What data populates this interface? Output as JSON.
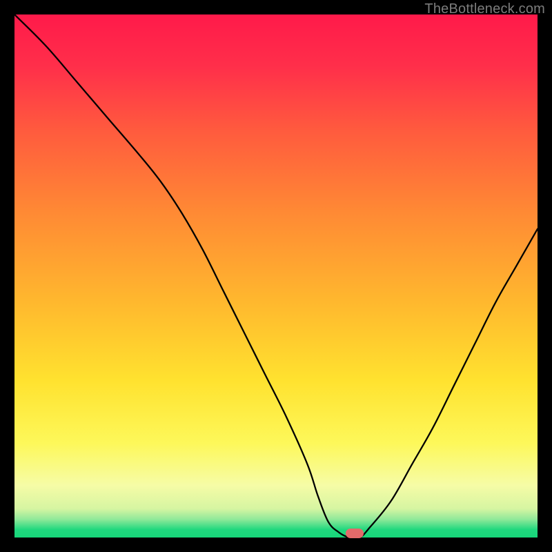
{
  "watermark": "TheBottleneck.com",
  "colors": {
    "black": "#000000",
    "curve_stroke": "#000000",
    "marker_fill": "#e46a6a",
    "gradient_stops": [
      {
        "pos": 0.0,
        "color": "#ff1a4a"
      },
      {
        "pos": 0.1,
        "color": "#ff2f4a"
      },
      {
        "pos": 0.22,
        "color": "#ff5a3e"
      },
      {
        "pos": 0.38,
        "color": "#ff8a34"
      },
      {
        "pos": 0.55,
        "color": "#ffb82e"
      },
      {
        "pos": 0.7,
        "color": "#ffe22f"
      },
      {
        "pos": 0.82,
        "color": "#fdf85a"
      },
      {
        "pos": 0.9,
        "color": "#f6fca6"
      },
      {
        "pos": 0.945,
        "color": "#d6f5a2"
      },
      {
        "pos": 0.965,
        "color": "#90e99a"
      },
      {
        "pos": 0.985,
        "color": "#20d87e"
      },
      {
        "pos": 1.0,
        "color": "#17d67a"
      }
    ]
  },
  "chart_data": {
    "type": "line",
    "xlabel": "",
    "ylabel": "",
    "xlim": [
      0,
      100
    ],
    "ylim": [
      0,
      100
    ],
    "title": "",
    "grid": false,
    "series": [
      {
        "name": "bottleneck-curve",
        "x": [
          0,
          6,
          12,
          18,
          24,
          28,
          32,
          36,
          40,
          44,
          48,
          52,
          56,
          58,
          60,
          62,
          64,
          66,
          68,
          72,
          76,
          80,
          84,
          88,
          92,
          96,
          100
        ],
        "y": [
          100,
          94,
          87,
          80,
          73,
          68,
          62,
          55,
          47,
          39,
          31,
          23,
          14,
          8,
          3,
          1,
          0,
          0,
          2,
          7,
          14,
          21,
          29,
          37,
          45,
          52,
          59
        ]
      }
    ],
    "marker": {
      "x": 65,
      "y": 0,
      "color": "#e46a6a"
    }
  }
}
